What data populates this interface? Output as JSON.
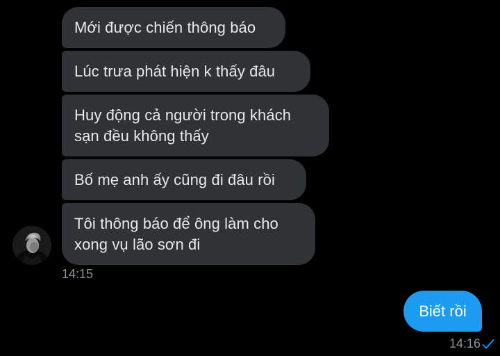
{
  "incoming": {
    "messages": [
      {
        "text": "Mới được chiến thông báo"
      },
      {
        "text": "Lúc trưa phát hiện k thấy đâu"
      },
      {
        "line1": "Huy động cả người trong khách",
        "line2": "sạn đều không thấy"
      },
      {
        "text": "Bố mẹ anh ấy cũng đi đâu rồi"
      },
      {
        "line1": "Tôi thông báo để ông làm cho",
        "line2": "xong vụ lão sơn đi"
      }
    ],
    "time": "14:15",
    "avatar_icon": "user-avatar-photo"
  },
  "outgoing": {
    "text": "Biết rồi",
    "time": "14:16",
    "status_icon": "check-icon"
  },
  "colors": {
    "background": "#000000",
    "incoming_bubble": "#2f3336",
    "outgoing_bubble": "#1d9bf0",
    "timestamp": "#8b9297",
    "check": "#1d9bf0"
  }
}
